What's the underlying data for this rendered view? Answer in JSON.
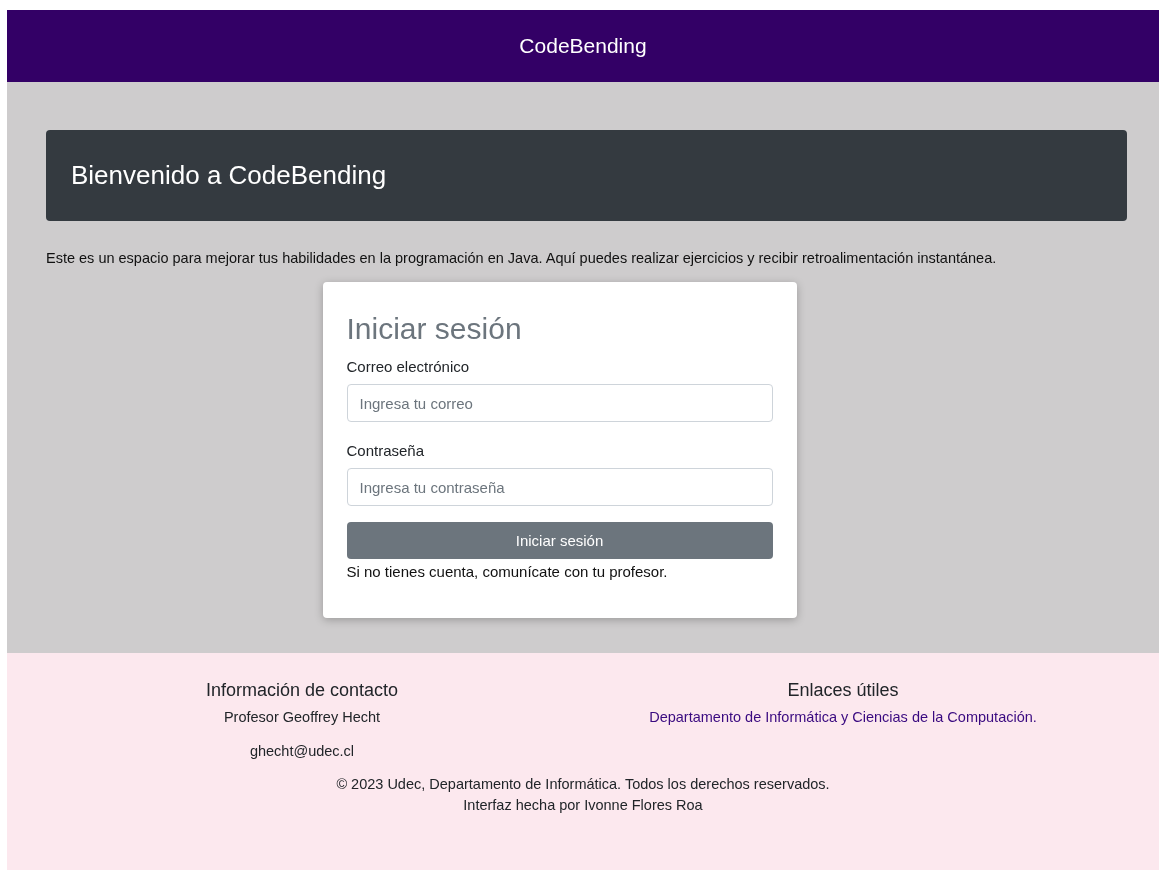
{
  "navbar": {
    "brand": "CodeBending"
  },
  "hero": {
    "title": "Bienvenido a CodeBending"
  },
  "intro": "Este es un espacio para mejorar tus habilidades en la programación en Java. Aquí puedes realizar ejercicios y recibir retroalimentación instantánea.",
  "login": {
    "title": "Iniciar sesión",
    "fields": [
      {
        "label": "Correo electrónico",
        "placeholder": "Ingresa tu correo"
      },
      {
        "label": "Contraseña",
        "placeholder": "Ingresa tu contraseña"
      }
    ],
    "button": "Iniciar sesión",
    "note": "Si no tienes cuenta, comunícate con tu profesor."
  },
  "footer": {
    "contact": {
      "title": "Información de contacto",
      "lines": [
        "Profesor Geoffrey Hecht",
        "ghecht@udec.cl"
      ]
    },
    "links": {
      "title": "Enlaces útiles",
      "items": [
        "Departamento de Informática y Ciencias de la Computación."
      ]
    },
    "copyright": [
      "© 2023 Udec, Departamento de Informática. Todos los derechos reservados.",
      "Interfaz hecha por Ivonne Flores Roa"
    ]
  }
}
